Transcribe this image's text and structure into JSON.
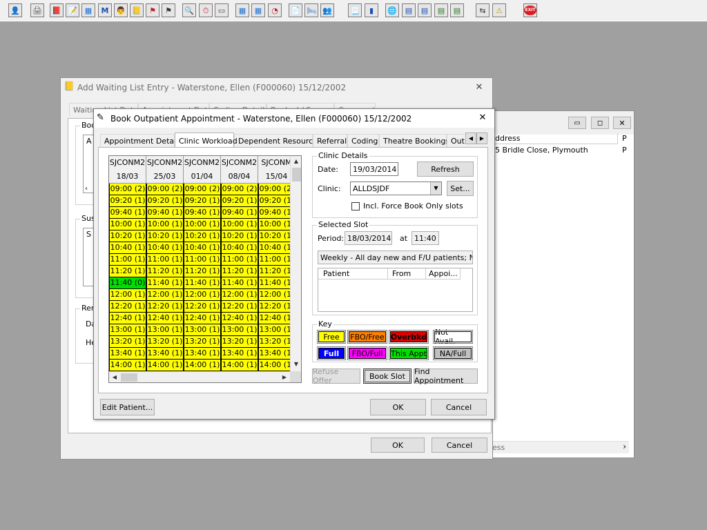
{
  "toolbar": {
    "buttons": [
      {
        "icon": "person-icon",
        "glyph": "👤"
      },
      {
        "icon": "printer-icon",
        "glyph": "🖨"
      },
      {
        "icon": "book-red-icon",
        "glyph": "📕"
      },
      {
        "icon": "book-edit-icon",
        "glyph": "📝"
      },
      {
        "icon": "network-icon",
        "glyph": "▦"
      },
      {
        "icon": "letter-m-icon",
        "glyph": "M"
      },
      {
        "icon": "doctor-icon",
        "glyph": "👨"
      },
      {
        "icon": "notebook-icon",
        "glyph": "📒"
      },
      {
        "icon": "flag-card-icon",
        "glyph": "⚑"
      },
      {
        "icon": "flag-card2-icon",
        "glyph": "⚑"
      },
      {
        "icon": "find-icon",
        "glyph": "🔍"
      },
      {
        "icon": "clock-icon",
        "glyph": "⏱"
      },
      {
        "icon": "monitor-icon",
        "glyph": "▭"
      },
      {
        "icon": "calendar-icon",
        "glyph": "▦"
      },
      {
        "icon": "calendar-edit-icon",
        "glyph": "▦"
      },
      {
        "icon": "globe-clock-icon",
        "glyph": "◔"
      },
      {
        "icon": "notes-icon",
        "glyph": "📄"
      },
      {
        "icon": "bed-icon",
        "glyph": "🛏"
      },
      {
        "icon": "users-icon",
        "glyph": "👥"
      },
      {
        "icon": "document-icon",
        "glyph": "📃"
      },
      {
        "icon": "chart-icon",
        "glyph": "▮"
      },
      {
        "icon": "globe-icon",
        "glyph": "🌐"
      },
      {
        "icon": "form-icon",
        "glyph": "▤"
      },
      {
        "icon": "form-check-icon",
        "glyph": "▤"
      },
      {
        "icon": "form-down-icon",
        "glyph": "▤"
      },
      {
        "icon": "form-arrow-icon",
        "glyph": "▤"
      },
      {
        "icon": "transfer-icon",
        "glyph": "⇆"
      },
      {
        "icon": "warning-icon",
        "glyph": "⚠"
      },
      {
        "icon": "exit-icon",
        "glyph": "EXIT"
      }
    ]
  },
  "waiting_list_window": {
    "title": "Add Waiting List Entry - Waterstone, Ellen (F000060) 15/12/2002",
    "tabs": [
      "Waiting List Details",
      "Appointment Details",
      "Coding Details",
      "Booked / Suspend",
      "Comments"
    ],
    "group_fragments": [
      "Boo",
      "A",
      "Sus",
      "S",
      "Rem",
      "Da",
      "He"
    ],
    "ok_label": "OK",
    "cancel_label": "Cancel"
  },
  "address_window": {
    "column_address": "ddress",
    "column_p": "P",
    "row_address": "5 Bridle Close, Plymouth",
    "row_p": "P",
    "bottom_text": "ess"
  },
  "dialog": {
    "title": "Book Outpatient Appointment - Waterstone, Ellen (F000060) 15/12/2002",
    "tabs": [
      "Appointment Details",
      "Clinic Workload",
      "Dependent Resources",
      "Referral",
      "Coding",
      "Theatre Bookings",
      "Out"
    ],
    "active_tab": "Clinic Workload",
    "grid": {
      "columns": [
        {
          "code": "SJCONM2",
          "date": "18/03"
        },
        {
          "code": "SJCONM2",
          "date": "25/03"
        },
        {
          "code": "SJCONM2",
          "date": "01/04"
        },
        {
          "code": "SJCONM2",
          "date": "08/04"
        },
        {
          "code": "SJCONM",
          "date": "15/04"
        }
      ],
      "times": [
        "09:00 (2)",
        "09:20 (1)",
        "09:40 (1)",
        "10:00 (1)",
        "10:20 (1)",
        "10:40 (1)",
        "11:00 (1)",
        "11:20 (1)",
        "11:40 (1)",
        "12:00 (1)",
        "12:20 (1)",
        "12:40 (1)",
        "13:00 (1)",
        "13:20 (1)",
        "13:40 (1)",
        "14:00 (1)"
      ],
      "selected_cell": "11:40 (0)"
    },
    "clinic_details": {
      "group_label": "Clinic Details",
      "date_label": "Date:",
      "date_value": "19/03/2014",
      "refresh_label": "Refresh",
      "clinic_label": "Clinic:",
      "clinic_value": "ALLDSJDF",
      "set_label": "Set...",
      "force_book_label": "Incl. Force Book Only slots"
    },
    "selected_slot": {
      "group_label": "Selected Slot",
      "period_label": "Period:",
      "period_value": "18/03/2014",
      "at_label": "at",
      "time_value": "11:40",
      "description": "Weekly - All day new and F/U patients; Neurol",
      "col_patient": "Patient",
      "col_from": "From",
      "col_appoi": "Appoi..."
    },
    "key": {
      "group_label": "Key",
      "items": [
        {
          "label": "Free",
          "bg": "#ffff00",
          "fg": "#000000"
        },
        {
          "label": "FBO/Free",
          "bg": "#ff8000",
          "fg": "#000000"
        },
        {
          "label": "Overbkd",
          "bg": "#e00000",
          "fg": "#000000"
        },
        {
          "label": "Not Avail.",
          "bg": "#ffffff",
          "fg": "#000000"
        },
        {
          "label": "Full",
          "bg": "#0000ff",
          "fg": "#ffffff"
        },
        {
          "label": "FBO/Full",
          "bg": "#ff00ff",
          "fg": "#000000"
        },
        {
          "label": "This Appt",
          "bg": "#00e000",
          "fg": "#000000"
        },
        {
          "label": "NA/Full",
          "bg": "#c0c0c0",
          "fg": "#000000"
        }
      ]
    },
    "refuse_offer_label": "Refuse Offer",
    "book_slot_label": "Book Slot",
    "find_appointment_label": "Find Appointment",
    "edit_patient_label": "Edit Patient...",
    "ok_label": "OK",
    "cancel_label": "Cancel"
  }
}
